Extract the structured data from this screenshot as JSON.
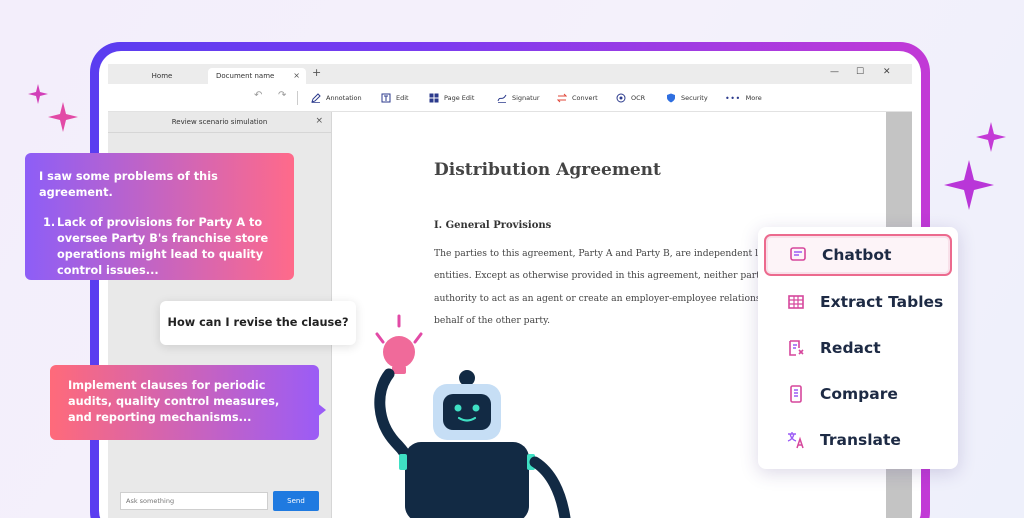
{
  "tabs": [
    {
      "label": "Home"
    },
    {
      "label": "Document name",
      "active": true
    }
  ],
  "tab_close": "×",
  "tab_add": "+",
  "window_controls": {
    "minimize": "—",
    "maximize": "☐",
    "close": "✕"
  },
  "toolbar": {
    "items": [
      {
        "label": "Annotation",
        "icon": "pen-icon"
      },
      {
        "label": "Edit",
        "icon": "edit-icon"
      },
      {
        "label": "Page Edit",
        "icon": "grid-icon"
      },
      {
        "label": "Signatur",
        "icon": "signature-icon"
      },
      {
        "label": "Convert",
        "icon": "convert-icon"
      },
      {
        "label": "OCR",
        "icon": "ocr-icon"
      },
      {
        "label": "Security",
        "icon": "shield-icon"
      },
      {
        "label": "More",
        "icon": "more-icon"
      }
    ]
  },
  "side_panel": {
    "title": "Review scenario simulation",
    "close": "×",
    "input_placeholder": "Ask something",
    "send_label": "Send"
  },
  "document": {
    "title": "Distribution Agreement",
    "heading": "I. General Provisions",
    "lines": [
      "The parties to this agreement, Party A and Party B, are independent l",
      "entities. Except as otherwise provided in this agreement, neither party",
      "authority to act as an agent or create an employer-employee relations",
      "behalf of the other party."
    ]
  },
  "chat": {
    "ai_message_intro": "I saw some problems of this agreement.",
    "ai_message_item_number": "1.",
    "ai_message_item": "Lack of provisions for Party A to oversee Party B's franchise store operations might lead to quality control issues...",
    "user_question": "How can I revise the clause?",
    "ai_suggestion": "Implement clauses for periodic audits, quality control measures, and reporting mechanisms..."
  },
  "features_menu": {
    "items": [
      {
        "label": "Chatbot",
        "icon": "chat-icon",
        "selected": true
      },
      {
        "label": "Extract Tables",
        "icon": "table-icon"
      },
      {
        "label": "Redact",
        "icon": "redact-icon"
      },
      {
        "label": "Compare",
        "icon": "compare-icon"
      },
      {
        "label": "Translate",
        "icon": "translate-icon"
      }
    ]
  },
  "colors": {
    "frame_gradient_start": "#5a3df0",
    "frame_gradient_end": "#c23ad6",
    "accent_pink": "#ec6a8e",
    "send_button": "#1f7ae0",
    "sparkle": "#c43ad6"
  }
}
